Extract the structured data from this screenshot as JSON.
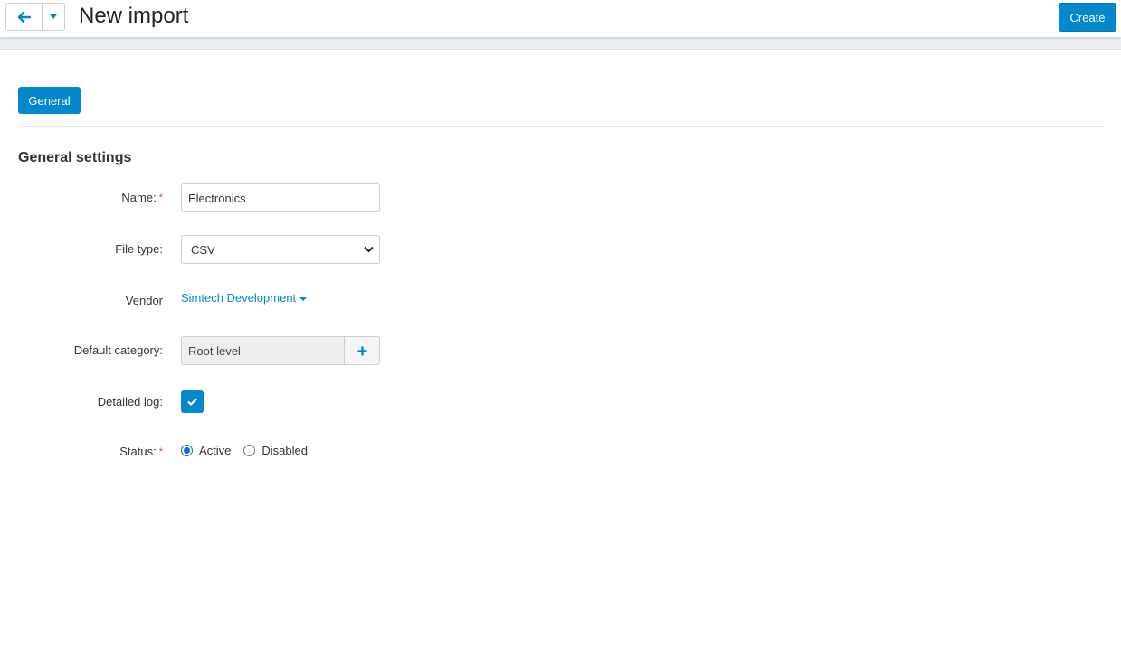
{
  "header": {
    "title": "New import",
    "create_label": "Create",
    "back_icon": "arrow-left-icon",
    "dropdown_icon": "caret-down-icon"
  },
  "tabs": [
    {
      "label": "General",
      "active": true
    }
  ],
  "section": {
    "title": "General settings"
  },
  "form": {
    "name": {
      "label": "Name:",
      "required": "*",
      "value": "Electronics"
    },
    "file_type": {
      "label": "File type:",
      "value": "CSV"
    },
    "vendor": {
      "label": "Vendor",
      "value": "Simtech Development"
    },
    "default_category": {
      "label": "Default category:",
      "value": "Root level",
      "add_icon": "plus-icon"
    },
    "detailed_log": {
      "label": "Detailed log:",
      "checked": true
    },
    "status": {
      "label": "Status:",
      "required": "*",
      "options": [
        {
          "label": "Active",
          "selected": true
        },
        {
          "label": "Disabled",
          "selected": false
        }
      ]
    }
  },
  "colors": {
    "accent": "#0388cc",
    "required": "#e0403a"
  }
}
